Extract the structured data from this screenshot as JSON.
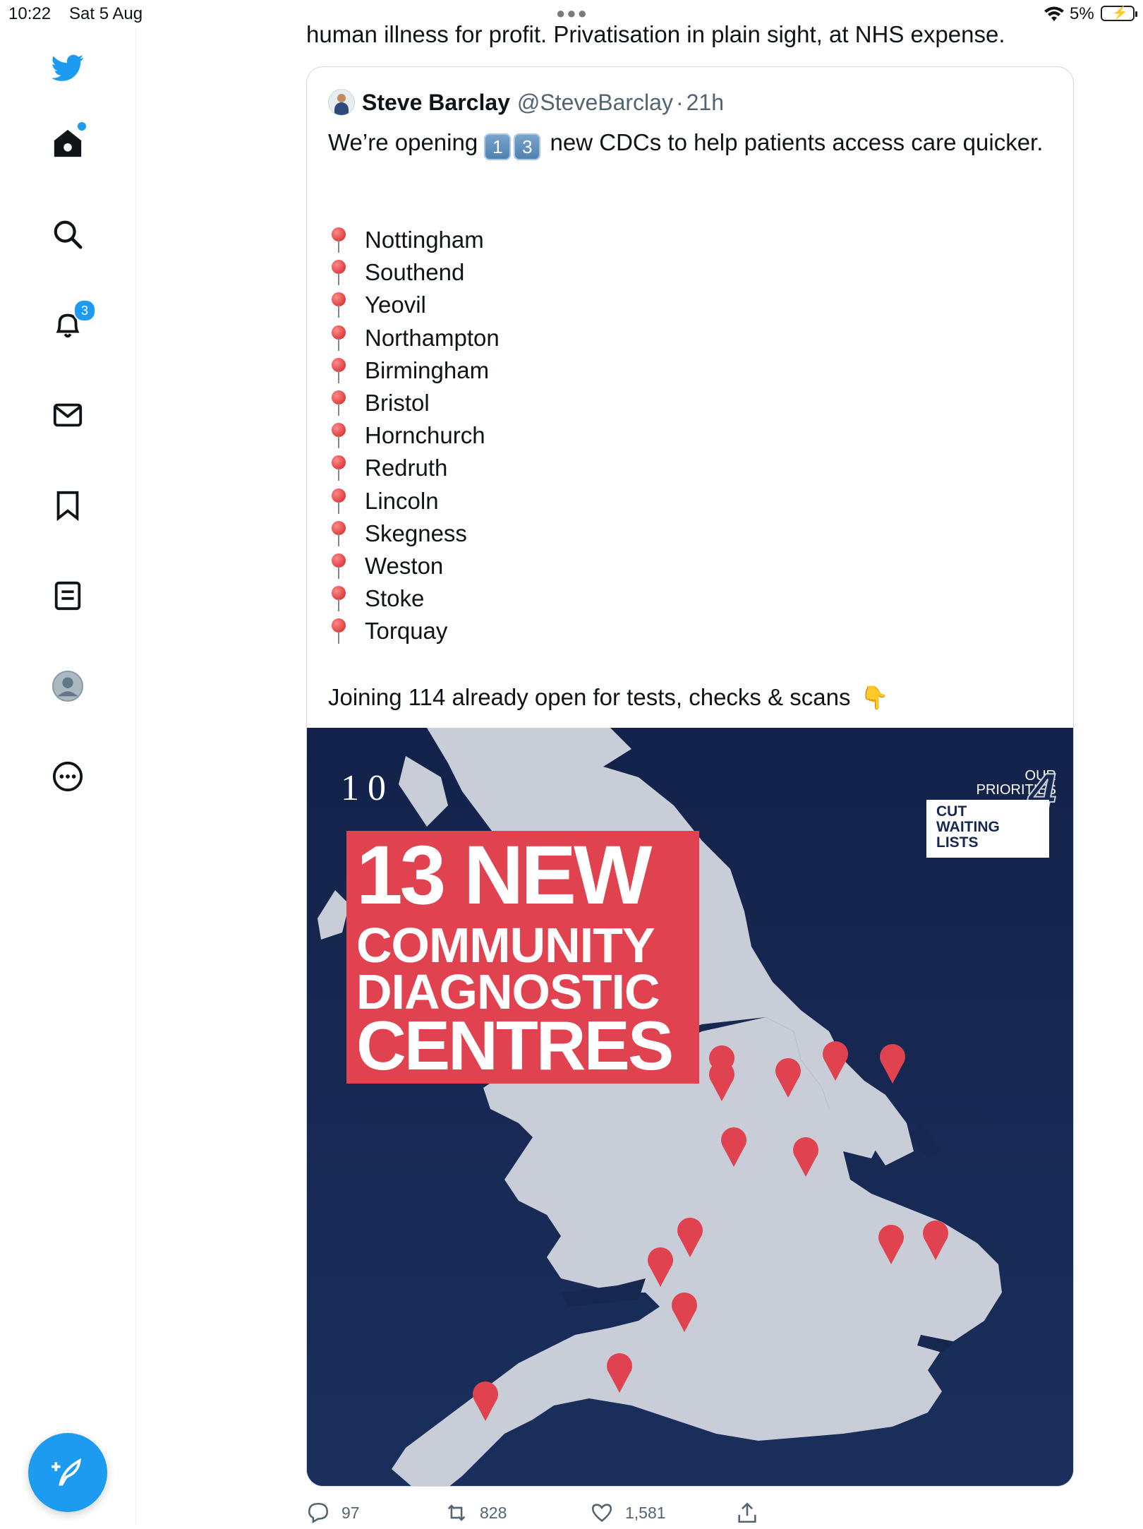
{
  "status_bar": {
    "time": "10:22",
    "date": "Sat 5 Aug",
    "battery_percent": "5%"
  },
  "sidebar": {
    "items": [
      {
        "icon": "twitter-bird-icon"
      },
      {
        "icon": "home-icon"
      },
      {
        "icon": "search-icon"
      },
      {
        "icon": "bell-icon",
        "badge": "3"
      },
      {
        "icon": "mail-icon"
      },
      {
        "icon": "bookmark-icon"
      },
      {
        "icon": "list-icon"
      },
      {
        "icon": "profile-avatar-icon"
      },
      {
        "icon": "more-icon"
      }
    ],
    "compose_icon": "feather-plus-icon"
  },
  "tweet": {
    "text_tail": "human illness for profit. Privatisation in plain sight, at NHS expense."
  },
  "quote": {
    "name": "Steve Barclay",
    "handle": "@SteveBarclay",
    "separator": "·",
    "time": "21h",
    "text_before": "We’re opening",
    "keycap_1": "1",
    "keycap_2": "3",
    "text_after": "new CDCs to help patients access care quicker.",
    "cities": [
      "Nottingham",
      "Southend",
      "Yeovil",
      "Northampton",
      "Birmingham",
      "Bristol",
      "Hornchurch",
      "Redruth",
      "Lincoln",
      "Skegness",
      "Weston",
      "Stoke",
      "Torquay"
    ],
    "footer": "Joining 114 already open for tests, checks & scans"
  },
  "image": {
    "logo": "10",
    "headline_1": "13 NEW",
    "headline_2": "COMMUNITY",
    "headline_3": "DIAGNOSTIC",
    "headline_4": "CENTRES",
    "priorities_label_1": "OUR",
    "priorities_label_2": "PRIORITIES",
    "priorities_number": "4",
    "priority_1": "CUT",
    "priority_2": "WAITING",
    "priority_3": "LISTS",
    "colors": {
      "background": "#16284f",
      "land": "#c8cdd8",
      "accent": "#e0424f"
    }
  },
  "actions": {
    "replies": "97",
    "retweets": "828",
    "likes": "1,581"
  }
}
